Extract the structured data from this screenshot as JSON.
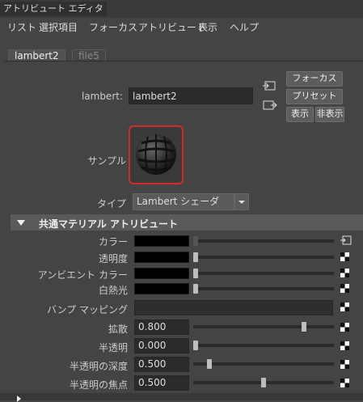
{
  "window": {
    "title": "アトリビュート エディタ"
  },
  "menu": [
    "リスト",
    "選択項目",
    "フォーカス",
    "アトリビュート",
    "表示",
    "ヘルプ"
  ],
  "tabs": [
    {
      "label": "lambert2",
      "active": true
    },
    {
      "label": "file5",
      "active": false
    }
  ],
  "node": {
    "label": "lambert:",
    "value": "lambert2"
  },
  "buttons": {
    "focus": "フォーカス",
    "preset": "プリセット",
    "show": "表示",
    "hide": "非表示"
  },
  "swatch": {
    "label": "サンプル"
  },
  "type": {
    "label": "タイプ",
    "value": "Lambert シェーダ"
  },
  "section": {
    "title": "共通マテリアル アトリビュート"
  },
  "color_attrs": [
    {
      "label": "カラー",
      "color": "#000000",
      "slider": 0.0,
      "icon": "connect-arrow-icon"
    },
    {
      "label": "透明度",
      "color": "#000000",
      "slider": 0.0,
      "icon": "checker-icon"
    },
    {
      "label": "アンビエント カラー",
      "color": "#000000",
      "slider": 0.0,
      "icon": "checker-icon"
    },
    {
      "label": "白熱光",
      "color": "#000000",
      "slider": 0.0,
      "icon": "checker-icon"
    }
  ],
  "bump": {
    "label": "バンプ マッピング"
  },
  "num_attrs": [
    {
      "label": "拡散",
      "value": "0.800",
      "slider": 0.8
    },
    {
      "label": "半透明",
      "value": "0.000",
      "slider": 0.0
    },
    {
      "label": "半透明の深度",
      "value": "0.500",
      "slider": 0.1
    },
    {
      "label": "半透明の焦点",
      "value": "0.500",
      "slider": 0.5
    }
  ]
}
